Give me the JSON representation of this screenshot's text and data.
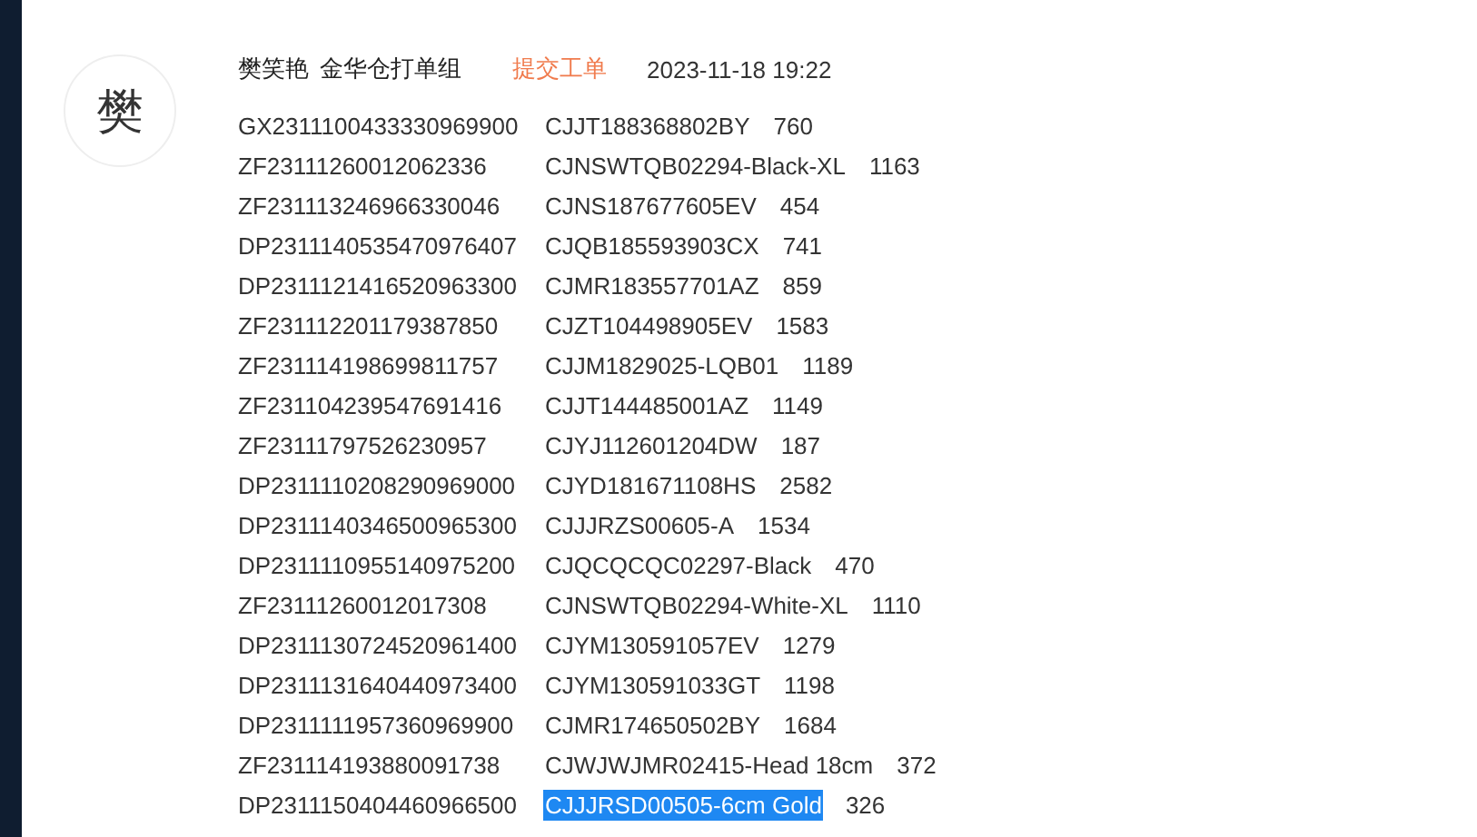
{
  "avatar": {
    "initial": "樊"
  },
  "header": {
    "name": "樊笑艳",
    "group": "金华仓打单组",
    "action": "提交工单",
    "time": "2023-11-18 19:22"
  },
  "rows": [
    {
      "order": "GX2311100433330969900",
      "sku": "CJJT188368802BY",
      "qty": "760",
      "selected": false
    },
    {
      "order": "ZF23111260012062336",
      "sku": "CJNSWTQB02294-Black-XL",
      "qty": "1163",
      "selected": false
    },
    {
      "order": "ZF231113246966330046",
      "sku": "CJNS187677605EV",
      "qty": "454",
      "selected": false
    },
    {
      "order": "DP2311140535470976407",
      "sku": "CJQB185593903CX",
      "qty": "741",
      "selected": false
    },
    {
      "order": "DP2311121416520963300",
      "sku": "CJMR183557701AZ",
      "qty": "859",
      "selected": false
    },
    {
      "order": "ZF231112201179387850",
      "sku": "CJZT104498905EV",
      "qty": "1583",
      "selected": false
    },
    {
      "order": "ZF231114198699811757",
      "sku": "CJJM1829025-LQB01",
      "qty": "1189",
      "selected": false
    },
    {
      "order": "ZF231104239547691416",
      "sku": "CJJT144485001AZ",
      "qty": "1149",
      "selected": false
    },
    {
      "order": "ZF23111797526230957",
      "sku": "CJYJ112601204DW",
      "qty": "187",
      "selected": false
    },
    {
      "order": "DP2311110208290969000",
      "sku": "CJYD181671108HS",
      "qty": "2582",
      "selected": false
    },
    {
      "order": "DP2311140346500965300",
      "sku": "CJJJRZS00605-A",
      "qty": "1534",
      "selected": false
    },
    {
      "order": "DP2311110955140975200",
      "sku": "CJQCQCQC02297-Black",
      "qty": "470",
      "selected": false
    },
    {
      "order": "ZF23111260012017308",
      "sku": "CJNSWTQB02294-White-XL",
      "qty": "1110",
      "selected": false
    },
    {
      "order": "DP2311130724520961400",
      "sku": "CJYM130591057EV",
      "qty": "1279",
      "selected": false
    },
    {
      "order": "DP2311131640440973400",
      "sku": "CJYM130591033GT",
      "qty": "1198",
      "selected": false
    },
    {
      "order": "DP2311111957360969900",
      "sku": "CJMR174650502BY",
      "qty": "1684",
      "selected": false
    },
    {
      "order": "ZF231114193880091738",
      "sku": "CJWJWJMR02415-Head 18cm",
      "qty": "372",
      "selected": false
    },
    {
      "order": "DP2311150404460966500",
      "sku": "CJJJRSD00505-6cm Gold",
      "qty": "326",
      "selected": true
    }
  ]
}
